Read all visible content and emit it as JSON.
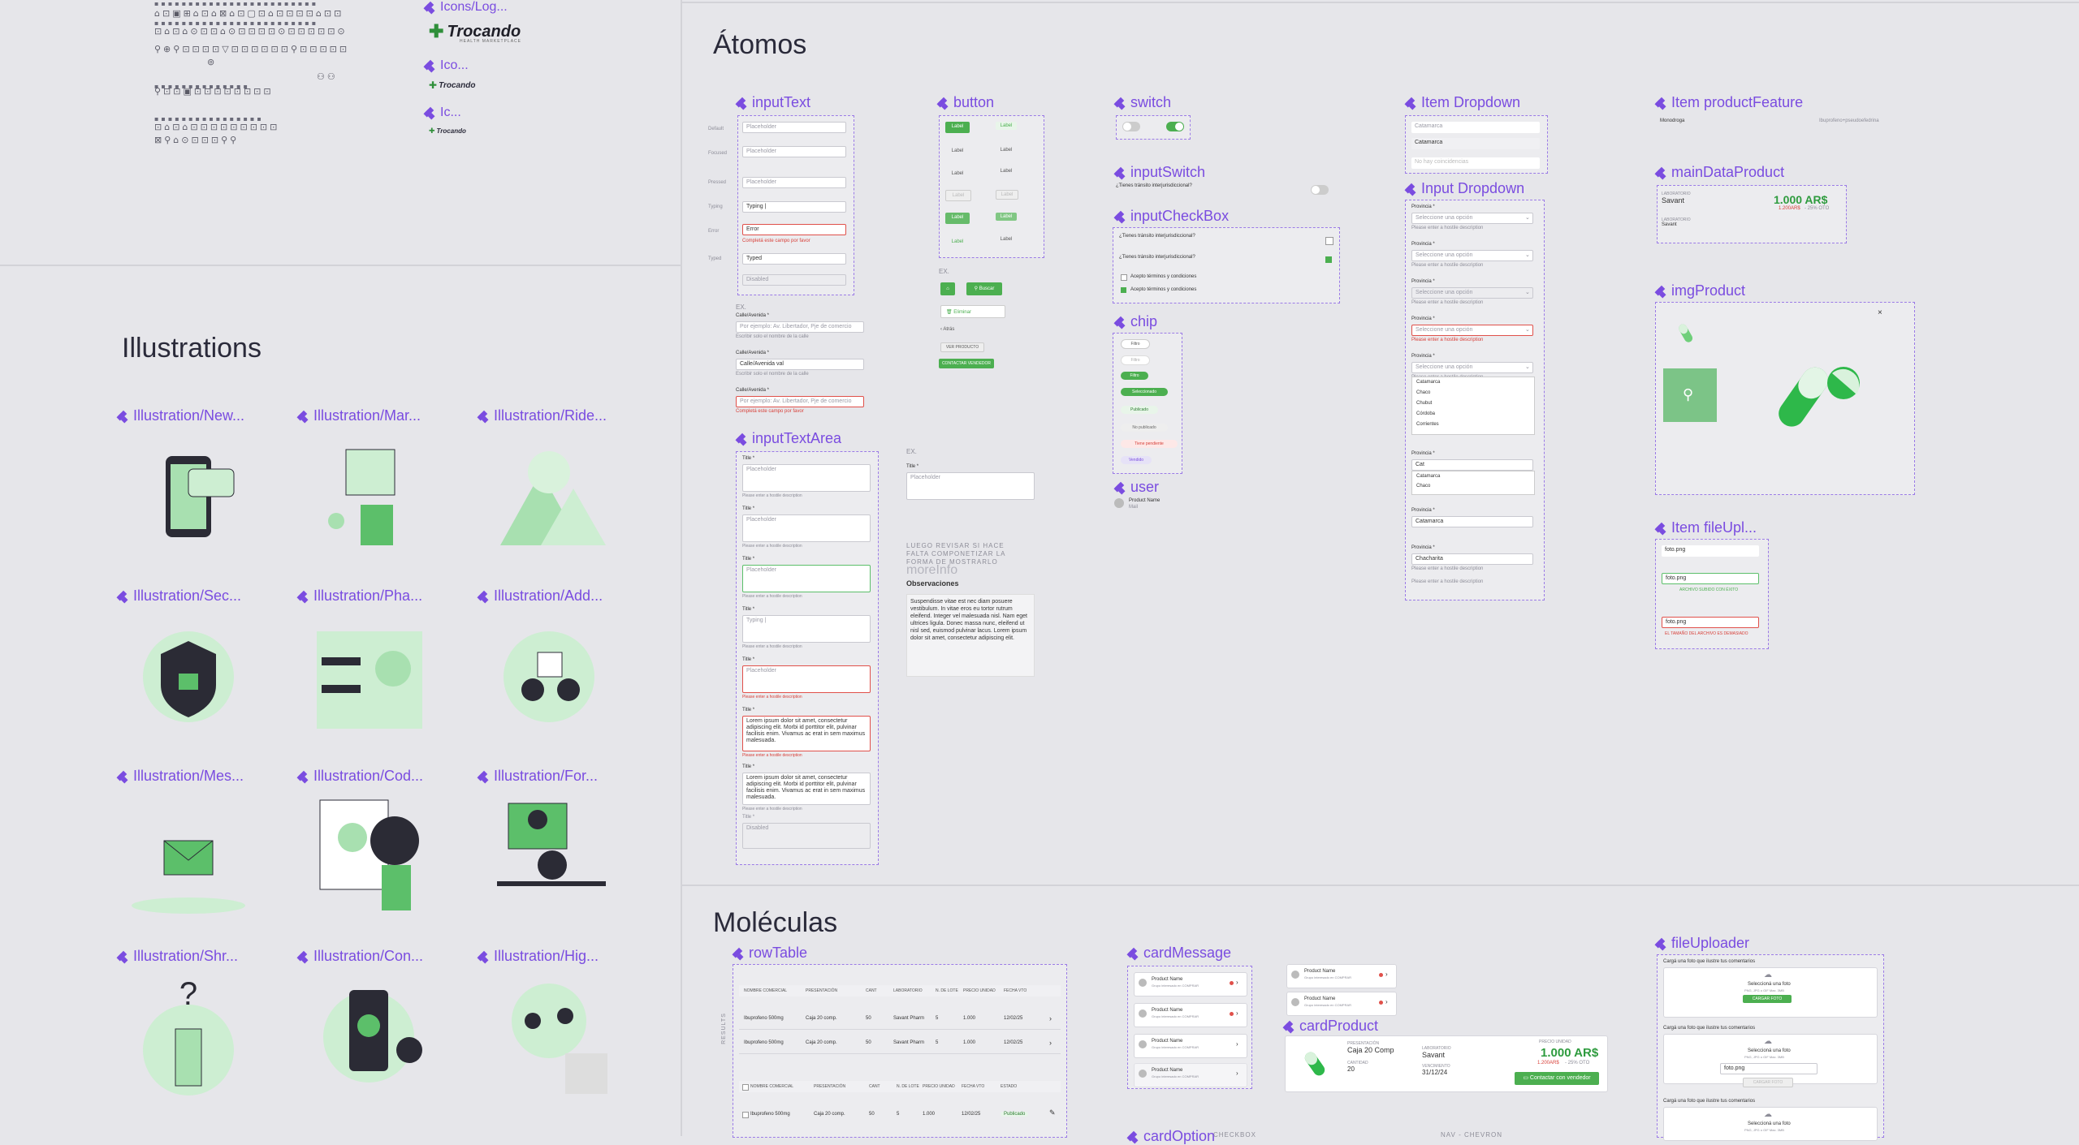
{
  "colors": {
    "accent": "#7a4ce0",
    "brand_green": "#4caf50",
    "bg": "#e6e6ea",
    "error": "#e0504a"
  },
  "top_left": {
    "icon_labels": [
      "Icons/Log...",
      "Ico...",
      "Ic..."
    ],
    "logo_text": "Trocando",
    "logo_sub": "HEALTH MARKETPLACE"
  },
  "illustrations": {
    "title": "Illustrations",
    "items": [
      "Illustration/New...",
      "Illustration/Mar...",
      "Illustration/Ride...",
      "Illustration/Sec...",
      "Illustration/Pha...",
      "Illustration/Add...",
      "Illustration/Mes...",
      "Illustration/Cod...",
      "Illustration/For...",
      "Illustration/Shr...",
      "Illustration/Con...",
      "Illustration/Hig..."
    ]
  },
  "atomos": {
    "title": "Átomos",
    "components": {
      "inputText": "inputText",
      "button": "button",
      "switch": "switch",
      "itemDropdown": "Item Dropdown",
      "itemProductFeature": "Item productFeature",
      "inputSwitch": "inputSwitch",
      "inputCheckBox": "inputCheckBox",
      "inputDropdown": "Input Dropdown",
      "mainDataProduct": "mainDataProduct",
      "chip": "chip",
      "imgProduct": "imgProduct",
      "user": "user",
      "inputTextArea": "inputTextArea",
      "itemFileUpload": "Item fileUpl..."
    },
    "input_text": {
      "placeholder": "Placeholder",
      "typing": "Typing |",
      "error": "Error",
      "typed": "Typed",
      "disabled": "Disabled",
      "ex": "EX.",
      "calle_label": "Calle/Avenida *",
      "calle_placeholder": "Por ejemplo: Av. Libertador, Pje de comercio",
      "calle_value": "Calle/Avenida val",
      "hint": "Escribir solo el nombre de la calle",
      "error_hint": "Completá este campo por favor"
    },
    "button": {
      "label": "Label",
      "ex": "EX.",
      "buscar": "Buscar",
      "eliminar": "Eliminar",
      "atras": "Atrás",
      "ver_producto": "VER PRODUCTO",
      "contactar": "CONTACTAR VENDEDOR"
    },
    "checkbox": {
      "question": "¿Tienes tránsito interjurisdiccional?",
      "accept": "Acepto términos y condiciones"
    },
    "chips": [
      "Filtro",
      "Filtro",
      "Filtro",
      "Seleccionado",
      "Publicado",
      "No publicado",
      "Tiene pendiente",
      "Vendido"
    ],
    "user": {
      "name": "Product Name",
      "sub": "Mail"
    },
    "textarea": {
      "title": "Title *",
      "placeholder": "Placeholder",
      "typing": "Typing |",
      "lorem": "Lorem ipsum dolor sit amet, consectetur adipiscing elit. Morbi id porttitor elit, pulvinar facilisis enim. Vivamus ac erat in sem maximus malesuada.",
      "disabled": "Disabled",
      "ex": "EX.",
      "note": "LUEGO REVISAR SI HACE FALTA COMPONETIZAR LA FORMA DE MOSTRARLO",
      "more_info": "moreInfo",
      "observaciones": "Observaciones",
      "obs_text": "Suspendisse vitae est nec diam posuere vestibulum. In vitae eros eu tortor rutrum eleifend. Integer vel malesuada nisl. Nam eget ultrices ligula. Donec massa nunc, eleifend ut nisl sed, euismod pulvinar lacus. Lorem ipsum dolor sit amet, consectetur adipiscing elit."
    },
    "dropdown": {
      "province_label": "Provincia *",
      "select_placeholder": "Seleccione una opción",
      "options": [
        "Catamarca",
        "Chaco",
        "Chubut",
        "Córdoba",
        "Corrientes"
      ],
      "catamarca": "Catamarca",
      "chacharita": "Chacharita",
      "cat": "Cat",
      "hint": "Please enter a hostile description"
    },
    "product_feature": {
      "left": "Monodroga",
      "right": "Ibuprofeno+pseudoefedrina"
    },
    "main_data": {
      "brand": "Savant",
      "lab": "Savant",
      "price": "1.000 AR$",
      "old_price": "1.200AR$",
      "discount": "- 25% OTO"
    },
    "file_item": "foto.png"
  },
  "moleculas": {
    "title": "Moléculas",
    "components": {
      "rowTable": "rowTable",
      "cardMessage": "cardMessage",
      "cardProduct": "cardProduct",
      "fileUploader": "fileUploader",
      "cardOption": "cardOption"
    },
    "table": {
      "headers": [
        "NOMBRE COMERCIAL",
        "PRESENTACIÓN",
        "CANT",
        "LABORATORIO",
        "N. DE LOTE",
        "PRECIO UNIDAD",
        "FECHA VTO"
      ],
      "headers2": [
        "NOMBRE COMERCIAL",
        "PRESENTACIÓN",
        "CANT",
        "N. DE LOTE",
        "PRECIO UNIDAD",
        "FECHA VTO",
        "ESTADO"
      ],
      "rows": [
        [
          "Ibuprofeno 500mg",
          "Caja 20 comp.",
          "50",
          "Savant Pharm",
          "5",
          "1.000",
          "12/02/25"
        ],
        [
          "Ibuprofeno 500mg",
          "Caja 20 comp.",
          "50",
          "Savant Pharm",
          "5",
          "1.000",
          "12/02/25"
        ]
      ],
      "row3": [
        "Ibuprofeno 500mg",
        "Caja 20 comp.",
        "50",
        "5",
        "1.000",
        "12/02/25",
        "Publicado"
      ],
      "side_label": "RESULTS"
    },
    "card_message": {
      "name": "Product Name",
      "sub": "Grupo interesado en COMPRAR"
    },
    "card_product": {
      "presentation": "Caja 20 Comp",
      "qty": "20",
      "lab": "Savant",
      "date": "31/12/24",
      "price": "1.000 AR$",
      "old_price": "1.200AR$",
      "discount": "- 25% OTO",
      "cta": "Contactar con vendedor"
    },
    "file_uploader": {
      "label": "Cargá una foto que ilustre tus comentarios",
      "select": "Seleccioná una foto",
      "hint": "PNG, JPG o GIF Max. 3MB",
      "btn": "CARGAR FOTO",
      "file": "foto.png"
    },
    "bottom_labels": [
      "CHECKBOX",
      "NAV - CHEVRON"
    ]
  }
}
